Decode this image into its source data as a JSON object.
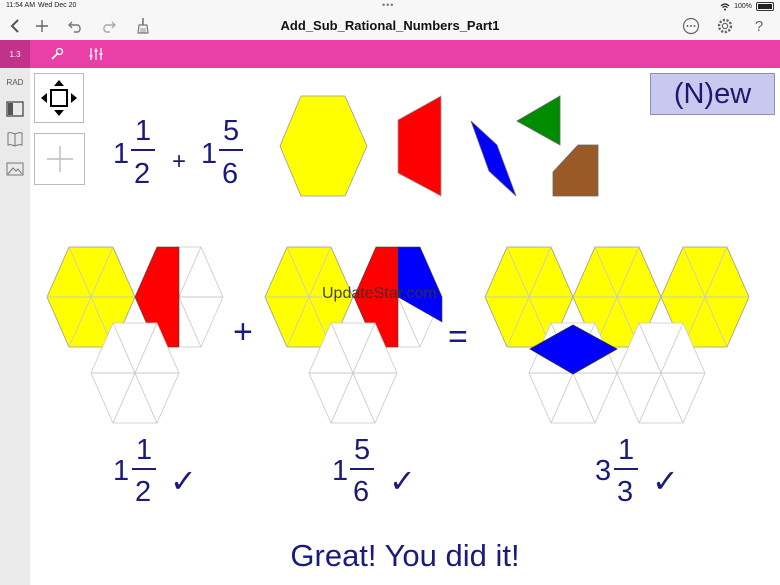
{
  "status_bar": {
    "time": "11:54 AM",
    "date": "Wed Dec 20",
    "battery": "100%"
  },
  "title_bar": {
    "document_title": "Add_Sub_Rational_Numbers_Part1"
  },
  "toolbar": {
    "page_number": "1.3"
  },
  "sidebar": {
    "mode": "RAD"
  },
  "new_button": {
    "label": "(N)ew"
  },
  "problem": {
    "addend1": {
      "whole": "1",
      "numerator": "1",
      "denominator": "2"
    },
    "plus": "+",
    "addend2": {
      "whole": "1",
      "numerator": "5",
      "denominator": "6"
    }
  },
  "results": {
    "left": {
      "whole": "1",
      "numerator": "1",
      "denominator": "2",
      "check": "✓"
    },
    "middle": {
      "whole": "1",
      "numerator": "5",
      "denominator": "6",
      "check": "✓"
    },
    "right": {
      "whole": "3",
      "numerator": "1",
      "denominator": "3",
      "check": "✓"
    }
  },
  "operators": {
    "plus": "+",
    "equals": "="
  },
  "message": "Great! You did it!",
  "watermark": "UpdateStar.com",
  "colors": {
    "pink_toolbar": "#ea3fa7",
    "hexagon": "#ffff00",
    "trapezoid": "#ff0000",
    "rhombus": "#0000ff",
    "triangle": "#008c00",
    "tan_rhombus": "#9a5a28",
    "text_navy": "#1b1b7a"
  }
}
